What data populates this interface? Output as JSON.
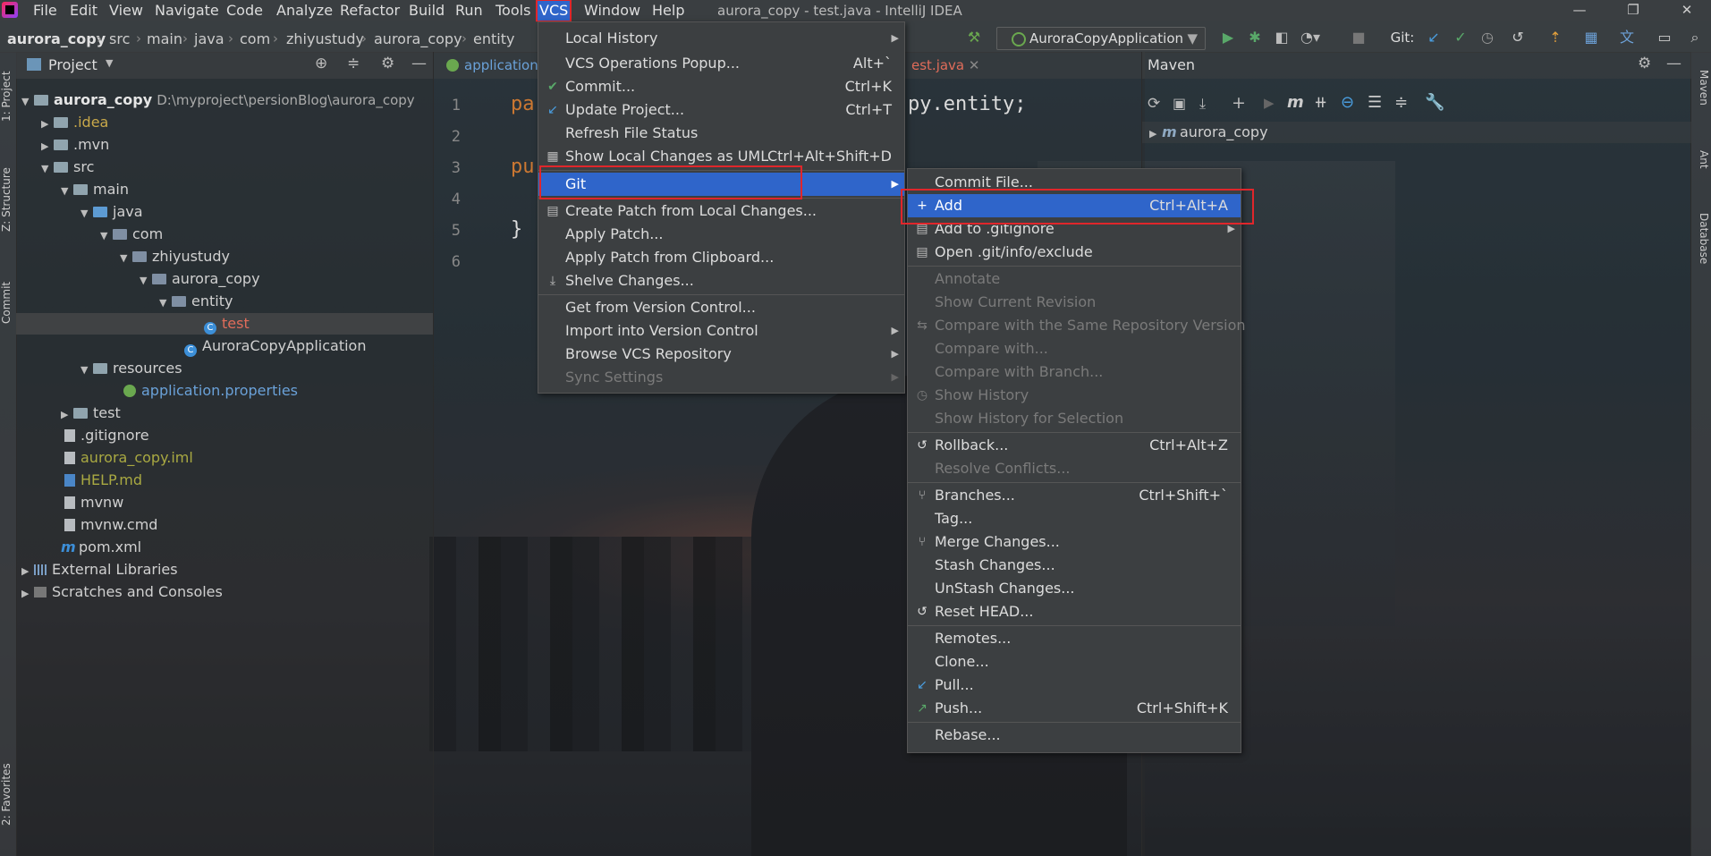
{
  "menubar": {
    "items": [
      "File",
      "Edit",
      "View",
      "Navigate",
      "Code",
      "Analyze",
      "Refactor",
      "Build",
      "Run",
      "Tools",
      "VCS",
      "Window",
      "Help"
    ],
    "window_title": "aurora_copy - test.java - IntelliJ IDEA"
  },
  "breadcrumb": [
    "aurora_copy",
    "src",
    "main",
    "java",
    "com",
    "zhiyustudy",
    "aurora_copy",
    "entity"
  ],
  "toolbar": {
    "run_config": "AuroraCopyApplication",
    "git_label": "Git:"
  },
  "left_stripe": {
    "tabs": [
      "1: Project",
      "Z: Structure",
      "Commit",
      "2: Favorites"
    ]
  },
  "right_stripe": {
    "tabs": [
      "Maven",
      "Ant",
      "Database"
    ]
  },
  "project": {
    "title": "Project",
    "tree": [
      {
        "label": "aurora_copy",
        "extra": "D:\\myproject\\persionBlog\\aurora_copy"
      },
      {
        "label": ".idea"
      },
      {
        "label": ".mvn"
      },
      {
        "label": "src"
      },
      {
        "label": "main"
      },
      {
        "label": "java"
      },
      {
        "label": "com"
      },
      {
        "label": "zhiyustudy"
      },
      {
        "label": "aurora_copy"
      },
      {
        "label": "entity"
      },
      {
        "label": "test"
      },
      {
        "label": "AuroraCopyApplication"
      },
      {
        "label": "resources"
      },
      {
        "label": "application.properties"
      },
      {
        "label": "test"
      },
      {
        "label": ".gitignore"
      },
      {
        "label": "aurora_copy.iml"
      },
      {
        "label": "HELP.md"
      },
      {
        "label": "mvnw"
      },
      {
        "label": "mvnw.cmd"
      },
      {
        "label": "pom.xml"
      },
      {
        "label": "External Libraries"
      },
      {
        "label": "Scratches and Consoles"
      }
    ]
  },
  "editor": {
    "tabs": [
      "application",
      "est.java"
    ],
    "line_numbers": [
      "1",
      "2",
      "3",
      "4",
      "5",
      "6"
    ],
    "code": [
      "pa",
      "py.entity;",
      "pu",
      "}"
    ]
  },
  "maven": {
    "title": "Maven",
    "root": "aurora_copy"
  },
  "vcs_menu": {
    "items": [
      {
        "label": "Local History",
        "shortcut": ""
      },
      {
        "label": "VCS Operations Popup...",
        "shortcut": "Alt+`"
      },
      {
        "label": "Commit...",
        "shortcut": "Ctrl+K"
      },
      {
        "label": "Update Project...",
        "shortcut": "Ctrl+T"
      },
      {
        "label": "Refresh File Status",
        "shortcut": ""
      },
      {
        "label": "Show Local Changes as UML",
        "shortcut": "Ctrl+Alt+Shift+D"
      },
      {
        "label": "Git",
        "shortcut": ""
      },
      {
        "label": "Create Patch from Local Changes...",
        "shortcut": ""
      },
      {
        "label": "Apply Patch...",
        "shortcut": ""
      },
      {
        "label": "Apply Patch from Clipboard...",
        "shortcut": ""
      },
      {
        "label": "Shelve Changes...",
        "shortcut": ""
      },
      {
        "label": "Get from Version Control...",
        "shortcut": ""
      },
      {
        "label": "Import into Version Control",
        "shortcut": ""
      },
      {
        "label": "Browse VCS Repository",
        "shortcut": ""
      },
      {
        "label": "Sync Settings",
        "shortcut": ""
      }
    ]
  },
  "git_menu": {
    "items": [
      {
        "label": "Commit File...",
        "shortcut": ""
      },
      {
        "label": "Add",
        "shortcut": "Ctrl+Alt+A"
      },
      {
        "label": "Add to .gitignore",
        "shortcut": ""
      },
      {
        "label": "Open .git/info/exclude",
        "shortcut": ""
      },
      {
        "label": "Annotate",
        "shortcut": ""
      },
      {
        "label": "Show Current Revision",
        "shortcut": ""
      },
      {
        "label": "Compare with the Same Repository Version",
        "shortcut": ""
      },
      {
        "label": "Compare with...",
        "shortcut": ""
      },
      {
        "label": "Compare with Branch...",
        "shortcut": ""
      },
      {
        "label": "Show History",
        "shortcut": ""
      },
      {
        "label": "Show History for Selection",
        "shortcut": ""
      },
      {
        "label": "Rollback...",
        "shortcut": "Ctrl+Alt+Z"
      },
      {
        "label": "Resolve Conflicts...",
        "shortcut": ""
      },
      {
        "label": "Branches...",
        "shortcut": "Ctrl+Shift+`"
      },
      {
        "label": "Tag...",
        "shortcut": ""
      },
      {
        "label": "Merge Changes...",
        "shortcut": ""
      },
      {
        "label": "Stash Changes...",
        "shortcut": ""
      },
      {
        "label": "UnStash Changes...",
        "shortcut": ""
      },
      {
        "label": "Reset HEAD...",
        "shortcut": ""
      },
      {
        "label": "Remotes...",
        "shortcut": ""
      },
      {
        "label": "Clone...",
        "shortcut": ""
      },
      {
        "label": "Pull...",
        "shortcut": ""
      },
      {
        "label": "Push...",
        "shortcut": "Ctrl+Shift+K"
      },
      {
        "label": "Rebase...",
        "shortcut": ""
      }
    ]
  },
  "colors": {
    "accent": "#2f65ca",
    "highlight_box": "#e0262b",
    "keyword": "#cc7832",
    "folder_orange": "#c8a84a"
  }
}
